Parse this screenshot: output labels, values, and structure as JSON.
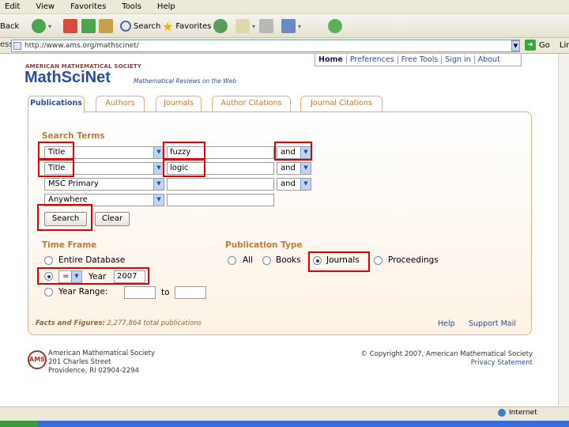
{
  "browser": {
    "menu": [
      "Edit",
      "View",
      "Favorites",
      "Tools",
      "Help"
    ],
    "toolbar": {
      "back": "Back",
      "search": "Search",
      "favorites": "Favorites"
    },
    "address_label": "ess",
    "address_url": "http://www.ams.org/mathscinet/",
    "go": "Go",
    "links": "Lin",
    "status_zone": "Internet"
  },
  "header": {
    "ams_top": "AMERICAN MATHEMATICAL SOCIETY",
    "logo": "MathSciNet",
    "tagline": "Mathematical Reviews on the Web",
    "nav": [
      "Home",
      "Preferences",
      "Free Tools",
      "Sign in",
      "About"
    ]
  },
  "tabs": [
    "Publications",
    "Authors",
    "Journals",
    "Author Citations",
    "Journal Citations"
  ],
  "search": {
    "title": "Search Terms",
    "rows": [
      {
        "field": "Title",
        "term": "fuzzy",
        "op": "and"
      },
      {
        "field": "Title",
        "term": "logic",
        "op": "and"
      },
      {
        "field": "MSC Primary",
        "term": "",
        "op": "and"
      },
      {
        "field": "Anywhere",
        "term": "",
        "op": ""
      }
    ],
    "search_button": "Search",
    "clear_button": "Clear"
  },
  "timeframe": {
    "title": "Time Frame",
    "entire": "Entire Database",
    "year_op": "=",
    "year_label": "Year",
    "year_value": "2007",
    "range_label": "Year Range:",
    "range_to": "to"
  },
  "pubtype": {
    "title": "Publication Type",
    "options": [
      "All",
      "Books",
      "Journals",
      "Proceedings"
    ],
    "selected": "Journals"
  },
  "facts": {
    "label": "Facts and Figures:",
    "text": " 2,277,864 total publications"
  },
  "links": {
    "help": "Help",
    "support": "Support Mail"
  },
  "footer": {
    "logo": "AMS",
    "org": "American Mathematical Society",
    "street": "201 Charles Street",
    "city": "Providence, RI 02904-2294",
    "copyright": "© Copyright 2007, American Mathematical Society",
    "privacy": "Privacy Statement"
  },
  "colors": {
    "accent": "#c07b35",
    "brand": "#2b4d9c",
    "highlight": "#e00000"
  }
}
